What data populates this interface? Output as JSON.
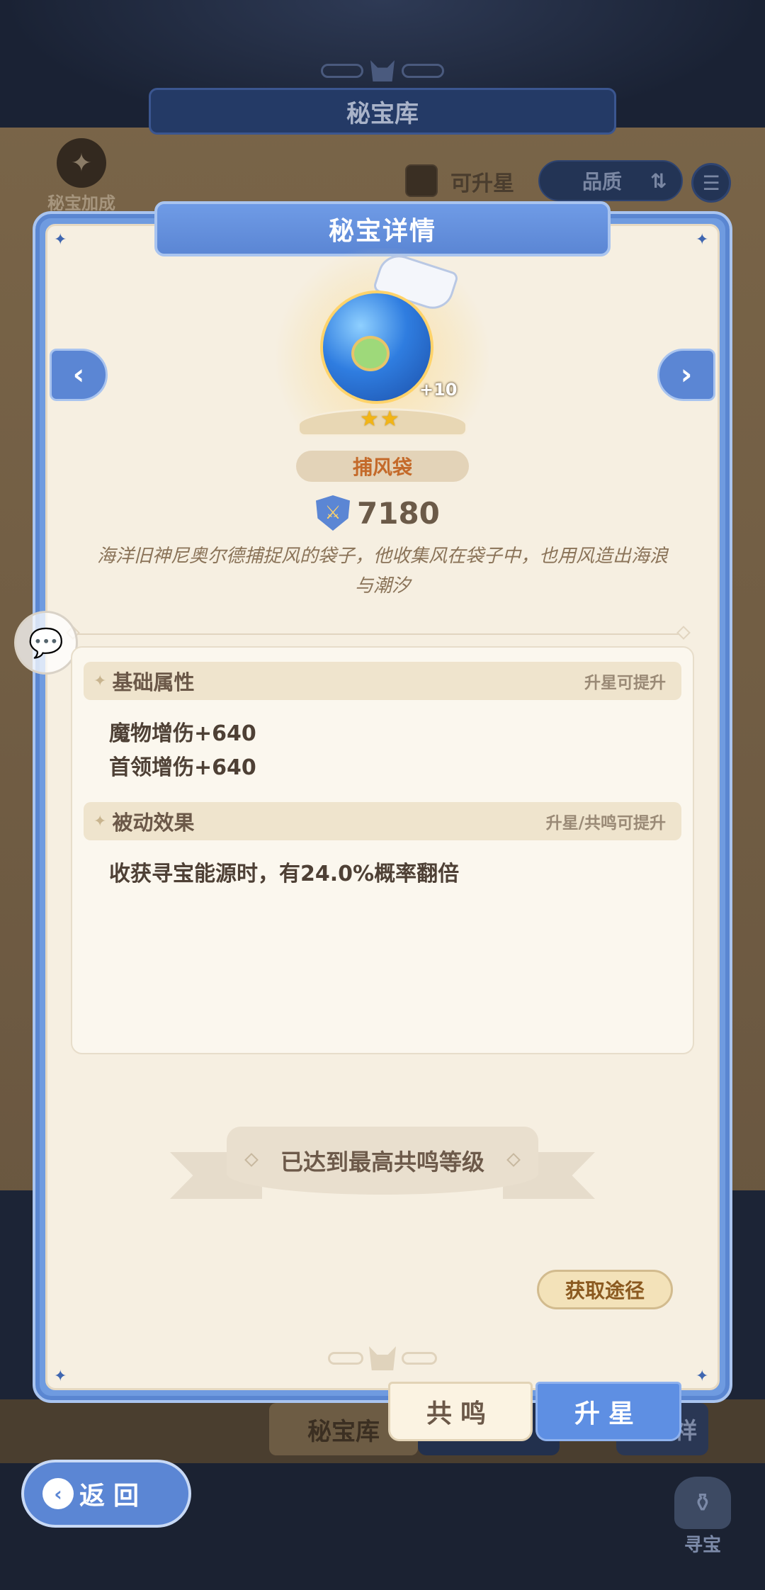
{
  "background": {
    "title": "秘宝库",
    "bonus_label": "秘宝加成",
    "upgradable_label": "可升星",
    "quality_label": "品质",
    "tab_vault_label": "秘宝库",
    "tab_right_label": "祥",
    "hunt_label": "寻宝"
  },
  "modal": {
    "title": "秘宝详情",
    "item": {
      "name": "捕风袋",
      "enhance_level": "+10",
      "stars": 2,
      "power": "7180",
      "description": "海洋旧神尼奥尔德捕捉风的袋子，他收集风在袋子中，也用风造出海浪与潮汐"
    },
    "base_attributes": {
      "title": "基础属性",
      "hint": "升星可提升",
      "lines": [
        "魔物增伤+640",
        "首领增伤+640"
      ]
    },
    "passive": {
      "title": "被动效果",
      "hint": "升星/共鸣可提升",
      "lines": [
        "收获寻宝能源时，有24.0%概率翻倍"
      ]
    },
    "max_banner": "已达到最高共鸣等级",
    "source_button": "获取途径"
  },
  "tabs": {
    "resonance": "共鸣",
    "upstar": "升星"
  },
  "back_button": "返回",
  "colors": {
    "frame_blue": "#6f9be0",
    "parchment": "#f6efe1",
    "accent_orange": "#c46a2a",
    "star_gold": "#f2b516"
  },
  "icons": {
    "prev": "chevron-left-icon",
    "next": "chevron-right-icon",
    "power": "shield-sword-icon",
    "chat": "chat-bubble-icon"
  }
}
